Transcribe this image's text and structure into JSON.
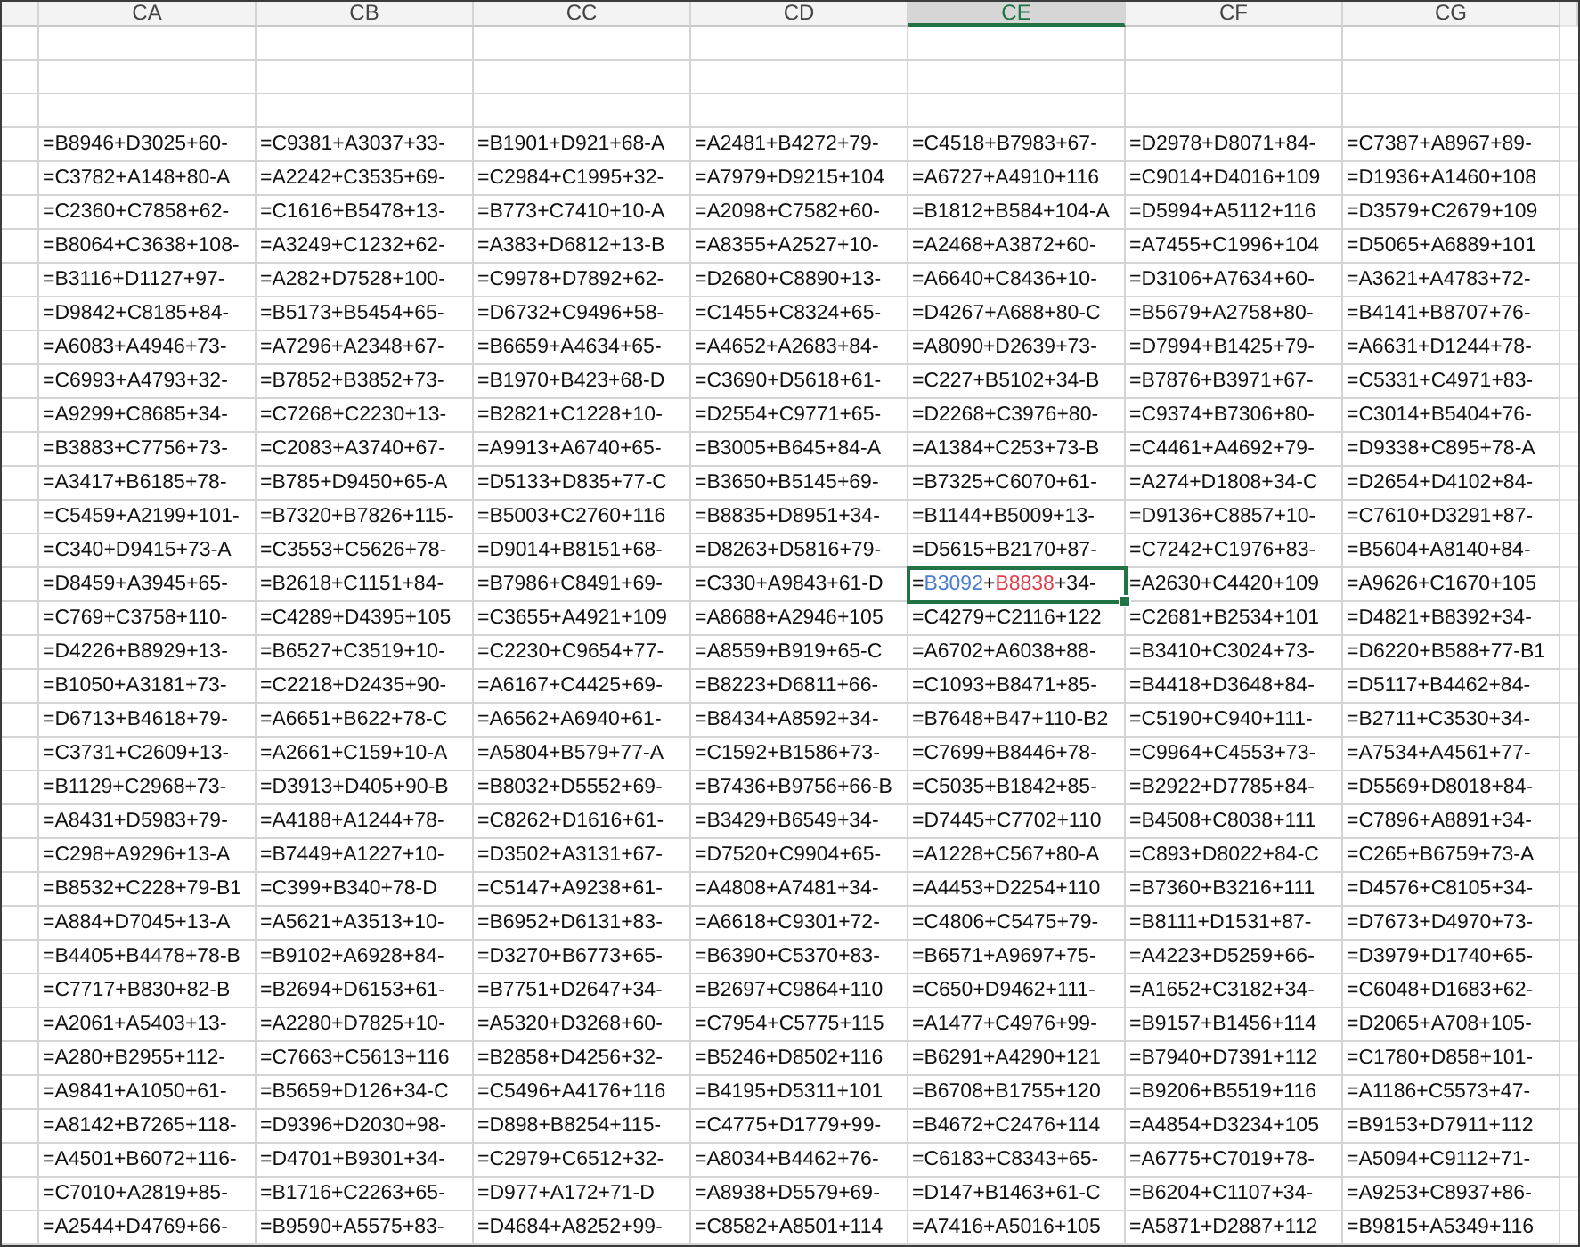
{
  "columns": [
    {
      "label": "CA",
      "selected": false
    },
    {
      "label": "CB",
      "selected": false
    },
    {
      "label": "CC",
      "selected": false
    },
    {
      "label": "CD",
      "selected": false
    },
    {
      "label": "CE",
      "selected": true
    },
    {
      "label": "CF",
      "selected": false
    },
    {
      "label": "CG",
      "selected": false
    }
  ],
  "rows": [
    {
      "cells": [
        "=B8946+D3025+60-",
        "=C9381+A3037+33-",
        "=B1901+D921+68-A",
        "=A2481+B4272+79-",
        "=C4518+B7983+67-",
        "=D2978+D8071+84-",
        "=C7387+A8967+89-"
      ]
    },
    {
      "cells": [
        "=C3782+A148+80-A",
        "=A2242+C3535+69-",
        "=C2984+C1995+32-",
        "=A7979+D9215+104",
        "=A6727+A4910+116",
        "=C9014+D4016+109",
        "=D1936+A1460+108"
      ]
    },
    {
      "cells": [
        "=C2360+C7858+62-",
        "=C1616+B5478+13-",
        "=B773+C7410+10-A",
        "=A2098+C7582+60-",
        "=B1812+B584+104-A",
        "=D5994+A5112+116",
        "=D3579+C2679+109"
      ]
    },
    {
      "cells": [
        "=B8064+C3638+108-",
        "=A3249+C1232+62-",
        "=A383+D6812+13-B",
        "=A8355+A2527+10-",
        "=A2468+A3872+60-",
        "=A7455+C1996+104",
        "=D5065+A6889+101"
      ]
    },
    {
      "cells": [
        "=B3116+D1127+97-",
        "=A282+D7528+100-",
        "=C9978+D7892+62-",
        "=D2680+C8890+13-",
        "=A6640+C8436+10-",
        "=D3106+A7634+60-",
        "=A3621+A4783+72-"
      ]
    },
    {
      "cells": [
        "=D9842+C8185+84-",
        "=B5173+B5454+65-",
        "=D6732+C9496+58-",
        "=C1455+C8324+65-",
        "=D4267+A688+80-C",
        "=B5679+A2758+80-",
        "=B4141+B8707+76-"
      ]
    },
    {
      "cells": [
        "=A6083+A4946+73-",
        "=A7296+A2348+67-",
        "=B6659+A4634+65-",
        "=A4652+A2683+84-",
        "=A8090+D2639+73-",
        "=D7994+B1425+79-",
        "=A6631+D1244+78-"
      ]
    },
    {
      "cells": [
        "=C6993+A4793+32-",
        "=B7852+B3852+73-",
        "=B1970+B423+68-D",
        "=C3690+D5618+61-",
        "=C227+B5102+34-B",
        "=B7876+B3971+67-",
        "=C5331+C4971+83-"
      ]
    },
    {
      "cells": [
        "=A9299+C8685+34-",
        "=C7268+C2230+13-",
        "=B2821+C1228+10-",
        "=D2554+C9771+65-",
        "=D2268+C3976+80-",
        "=C9374+B7306+80-",
        "=C3014+B5404+76-"
      ]
    },
    {
      "cells": [
        "=B3883+C7756+73-",
        "=C2083+A3740+67-",
        "=A9913+A6740+65-",
        "=B3005+B645+84-A",
        "=A1384+C253+73-B",
        "=C4461+A4692+79-",
        "=D9338+C895+78-A"
      ]
    },
    {
      "cells": [
        "=A3417+B6185+78-",
        "=B785+D9450+65-A",
        "=D5133+D835+77-C",
        "=B3650+B5145+69-",
        "=B7325+C6070+61-",
        "=A274+D1808+34-C",
        "=D2654+D4102+84-"
      ]
    },
    {
      "cells": [
        "=C5459+A2199+101-",
        "=B7320+B7826+115-",
        "=B5003+C2760+116",
        "=B8835+D8951+34-",
        "=B1144+B5009+13-",
        "=D9136+C8857+10-",
        "=C7610+D3291+87-"
      ]
    },
    {
      "cells": [
        "=C340+D9415+73-A",
        "=C3553+C5626+78-",
        "=D9014+B8151+68-",
        "=D8263+D5816+79-",
        "=D5615+B2170+87-",
        "=C7242+C1976+83-",
        "=B5604+A8140+84-"
      ]
    },
    {
      "cells": [
        "=D8459+A3945+65-",
        "=B2618+C1151+84-",
        "=B7986+C8491+69-",
        "=C330+A9843+61-D",
        {
          "active": true,
          "segments": [
            {
              "text": "="
            },
            {
              "text": "B3092",
              "color": "#4a7bd0"
            },
            {
              "text": "+"
            },
            {
              "text": "B8838",
              "color": "#e0404e"
            },
            {
              "text": "+34-"
            }
          ]
        },
        "=A2630+C4420+109",
        "=A9626+C1670+105"
      ]
    },
    {
      "cells": [
        "=C769+C3758+110-",
        "=C4289+D4395+105",
        "=C3655+A4921+109",
        "=A8688+A2946+105",
        "=C4279+C2116+122",
        "=C2681+B2534+101",
        "=D4821+B8392+34-"
      ]
    },
    {
      "cells": [
        "=D4226+B8929+13-",
        "=B6527+C3519+10-",
        "=C2230+C9654+77-",
        "=A8559+B919+65-C",
        "=A6702+A6038+88-",
        "=B3410+C3024+73-",
        "=D6220+B588+77-B1"
      ]
    },
    {
      "cells": [
        "=B1050+A3181+73-",
        "=C2218+D2435+90-",
        "=A6167+C4425+69-",
        "=B8223+D6811+66-",
        "=C1093+B8471+85-",
        "=B4418+D3648+84-",
        "=D5117+B4462+84-"
      ]
    },
    {
      "cells": [
        "=D6713+B4618+79-",
        "=A6651+B622+78-C",
        "=A6562+A6940+61-",
        "=B8434+A8592+34-",
        "=B7648+B47+110-B2",
        "=C5190+C940+111-",
        "=B2711+C3530+34-"
      ]
    },
    {
      "cells": [
        "=C3731+C2609+13-",
        "=A2661+C159+10-A",
        "=A5804+B579+77-A",
        "=C1592+B1586+73-",
        "=C7699+B8446+78-",
        "=C9964+C4553+73-",
        "=A7534+A4561+77-"
      ]
    },
    {
      "cells": [
        "=B1129+C2968+73-",
        "=D3913+D405+90-B",
        "=B8032+D5552+69-",
        "=B7436+B9756+66-B",
        "=C5035+B1842+85-",
        "=B2922+D7785+84-",
        "=D5569+D8018+84-"
      ]
    },
    {
      "cells": [
        "=A8431+D5983+79-",
        "=A4188+A1244+78-",
        "=C8262+D1616+61-",
        "=B3429+B6549+34-",
        "=D7445+C7702+110",
        "=B4508+C8038+111",
        "=C7896+A8891+34-"
      ]
    },
    {
      "cells": [
        "=C298+A9296+13-A",
        "=B7449+A1227+10-",
        "=D3502+A3131+67-",
        "=D7520+C9904+65-",
        "=A1228+C567+80-A",
        "=C893+D8022+84-C",
        "=C265+B6759+73-A"
      ]
    },
    {
      "cells": [
        "=B8532+C228+79-B1",
        "=C399+B340+78-D",
        "=C5147+A9238+61-",
        "=A4808+A7481+34-",
        "=A4453+D2254+110",
        "=B7360+B3216+111",
        "=D4576+C8105+34-"
      ]
    },
    {
      "cells": [
        "=A884+D7045+13-A",
        "=A5621+A3513+10-",
        "=B6952+D6131+83-",
        "=A6618+C9301+72-",
        "=C4806+C5475+79-",
        "=B8111+D1531+87-",
        "=D7673+D4970+73-"
      ]
    },
    {
      "cells": [
        "=B4405+B4478+78-B",
        "=B9102+A6928+84-",
        "=D3270+B6773+65-",
        "=B6390+C5370+83-",
        "=B6571+A9697+75-",
        "=A4223+D5259+66-",
        "=D3979+D1740+65-"
      ]
    },
    {
      "cells": [
        "=C7717+B830+82-B",
        "=B2694+D6153+61-",
        "=B7751+D2647+34-",
        "=B2697+C9864+110",
        "=C650+D9462+111-",
        "=A1652+C3182+34-",
        "=C6048+D1683+62-"
      ]
    },
    {
      "cells": [
        "=A2061+A5403+13-",
        "=A2280+D7825+10-",
        "=A5320+D3268+60-",
        "=C7954+C5775+115",
        "=A1477+C4976+99-",
        "=B9157+B1456+114",
        "=D2065+A708+105-"
      ]
    },
    {
      "cells": [
        "=A280+B2955+112-",
        "=C7663+C5613+116",
        "=B2858+D4256+32-",
        "=B5246+D8502+116",
        "=B6291+A4290+121",
        "=B7940+D7391+112",
        "=C1780+D858+101-"
      ]
    },
    {
      "cells": [
        "=A9841+A1050+61-",
        "=B5659+D126+34-C",
        "=C5496+A4176+116",
        "=B4195+D5311+101",
        "=B6708+B1755+120",
        "=B9206+B5519+116",
        "=A1186+C5573+47-"
      ]
    },
    {
      "cells": [
        "=A8142+B7265+118-",
        "=D9396+D2030+98-",
        "=D898+B8254+115-",
        "=C4775+D1779+99-",
        "=B4672+C2476+114",
        "=A4854+D3234+105",
        "=B9153+D7911+112"
      ]
    },
    {
      "cells": [
        "=A4501+B6072+116-",
        "=D4701+B9301+34-",
        "=C2979+C6512+32-",
        "=A8034+B4462+76-",
        "=C6183+C8343+65-",
        "=A6775+C7019+78-",
        "=A5094+C9112+71-"
      ]
    },
    {
      "cells": [
        "=C7010+A2819+85-",
        "=B1716+C2263+65-",
        "=D977+A172+71-D",
        "=A8938+D5579+69-",
        "=D147+B1463+61-C",
        "=B6204+C1107+34-",
        "=A9253+C8937+86-"
      ]
    },
    {
      "cells": [
        "=A2544+D4769+66-",
        "=B9590+A5575+83-",
        "=D4684+A8252+99-",
        "=C8582+A8501+114",
        "=A7416+A5016+105",
        "=A5871+D2887+112",
        "=B9815+A5349+116"
      ]
    }
  ]
}
